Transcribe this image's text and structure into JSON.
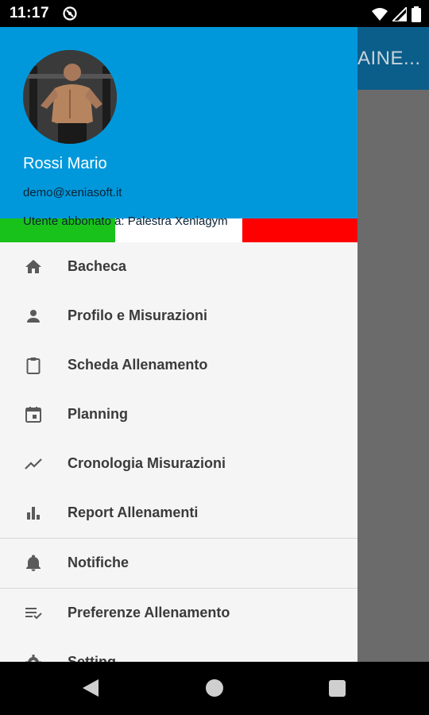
{
  "status_bar": {
    "time": "11:17",
    "icons": [
      "app-notification-icon",
      "wifi-icon",
      "signal-icon",
      "battery-icon"
    ]
  },
  "background_app": {
    "title_fragment": "AINE..."
  },
  "drawer": {
    "header": {
      "name": "Rossi Mario",
      "email": "demo@xeniasoft.it",
      "subscription": "Utente abbonato a: Palestra Xeniagym",
      "header_color": "#0098db",
      "flag_colors": [
        "#19c21a",
        "#ffffff",
        "#ff0000"
      ]
    },
    "menu": [
      {
        "label": "Bacheca",
        "icon": "home-icon"
      },
      {
        "label": "Profilo e Misurazioni",
        "icon": "person-icon"
      },
      {
        "label": "Scheda Allenamento",
        "icon": "clipboard-icon"
      },
      {
        "label": "Planning",
        "icon": "calendar-icon"
      },
      {
        "label": "Cronologia Misurazioni",
        "icon": "trending-icon"
      },
      {
        "label": "Report Allenamenti",
        "icon": "bar-chart-icon"
      },
      {
        "label": "Notifiche",
        "icon": "bell-icon"
      },
      {
        "label": "Preferenze Allenamento",
        "icon": "playlist-check-icon"
      },
      {
        "label": "Setting",
        "icon": "gear-icon"
      }
    ]
  }
}
